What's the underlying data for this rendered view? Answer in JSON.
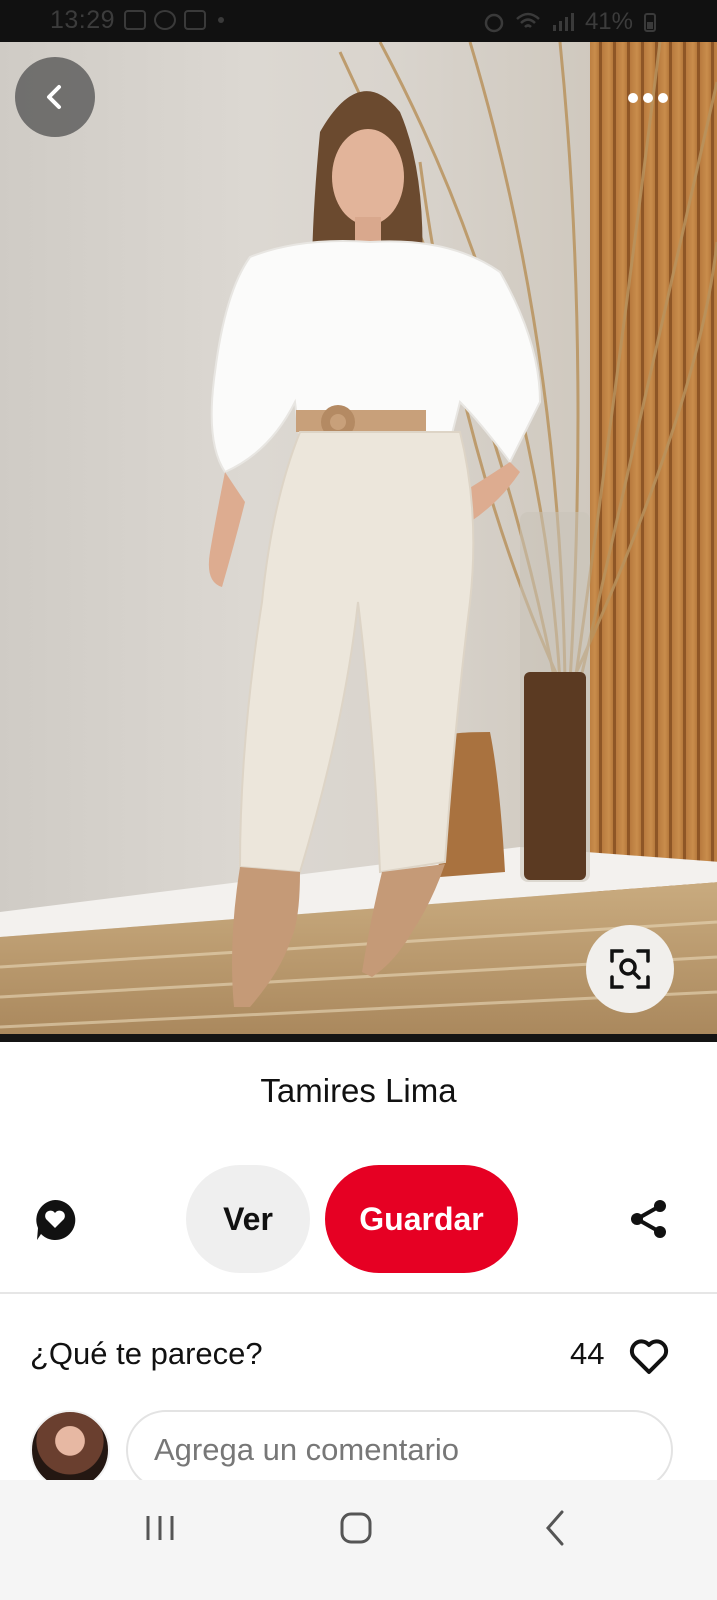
{
  "status_bar": {
    "time": "13:29",
    "battery": "41%",
    "icons_left": [
      "gallery-icon",
      "whatsapp-icon",
      "youtube-icon",
      "dot-icon"
    ],
    "icons_right": [
      "alarm-icon",
      "wifi-icon",
      "signal-icon",
      "battery-icon"
    ]
  },
  "photo": {
    "back_icon": "chevron-left-icon",
    "more_icon": "more-dots-icon",
    "visual_search_icon": "visual-search-icon"
  },
  "pin": {
    "author": "Tamires Lima"
  },
  "actions": {
    "comment_icon": "comment-heart-icon",
    "view_label": "Ver",
    "save_label": "Guardar",
    "share_icon": "share-icon",
    "save_color": "#e60023"
  },
  "reactions": {
    "prompt": "¿Qué te parece?",
    "count": "44",
    "heart_icon": "heart-outline-icon"
  },
  "comment": {
    "placeholder": "Agrega un comentario"
  },
  "nav": {
    "recents_icon": "recents-icon",
    "home_icon": "home-icon",
    "back_icon": "back-icon"
  }
}
